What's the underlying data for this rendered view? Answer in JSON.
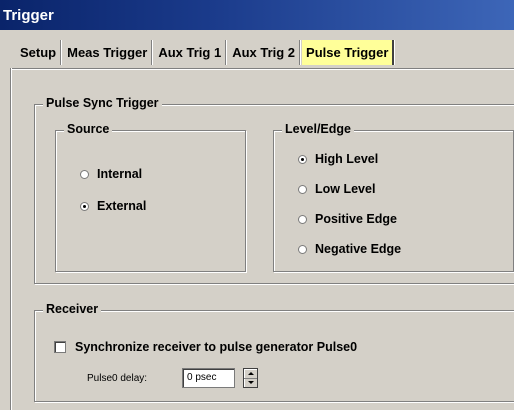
{
  "window": {
    "title": "Trigger"
  },
  "tabs": [
    {
      "label": "Setup"
    },
    {
      "label": "Meas Trigger"
    },
    {
      "label": "Aux Trig 1"
    },
    {
      "label": "Aux Trig 2"
    },
    {
      "label": "Pulse Trigger",
      "active": true
    }
  ],
  "pulse_sync": {
    "group_label": "Pulse Sync Trigger",
    "source": {
      "group_label": "Source",
      "options": [
        {
          "label": "Internal",
          "selected": false
        },
        {
          "label": "External",
          "selected": true
        }
      ]
    },
    "level_edge": {
      "group_label": "Level/Edge",
      "options": [
        {
          "label": "High Level",
          "selected": true
        },
        {
          "label": "Low Level",
          "selected": false
        },
        {
          "label": "Positive Edge",
          "selected": false
        },
        {
          "label": "Negative Edge",
          "selected": false
        }
      ]
    }
  },
  "receiver": {
    "group_label": "Receiver",
    "sync_checkbox_label": "Synchronize receiver to pulse generator Pulse0",
    "sync_checked": false,
    "delay_label": "Pulse0 delay:",
    "delay_value": "0 psec"
  },
  "colors": {
    "titlebar": "#0a246a",
    "face": "#d4d0c8",
    "active_tab": "#ffff99"
  }
}
